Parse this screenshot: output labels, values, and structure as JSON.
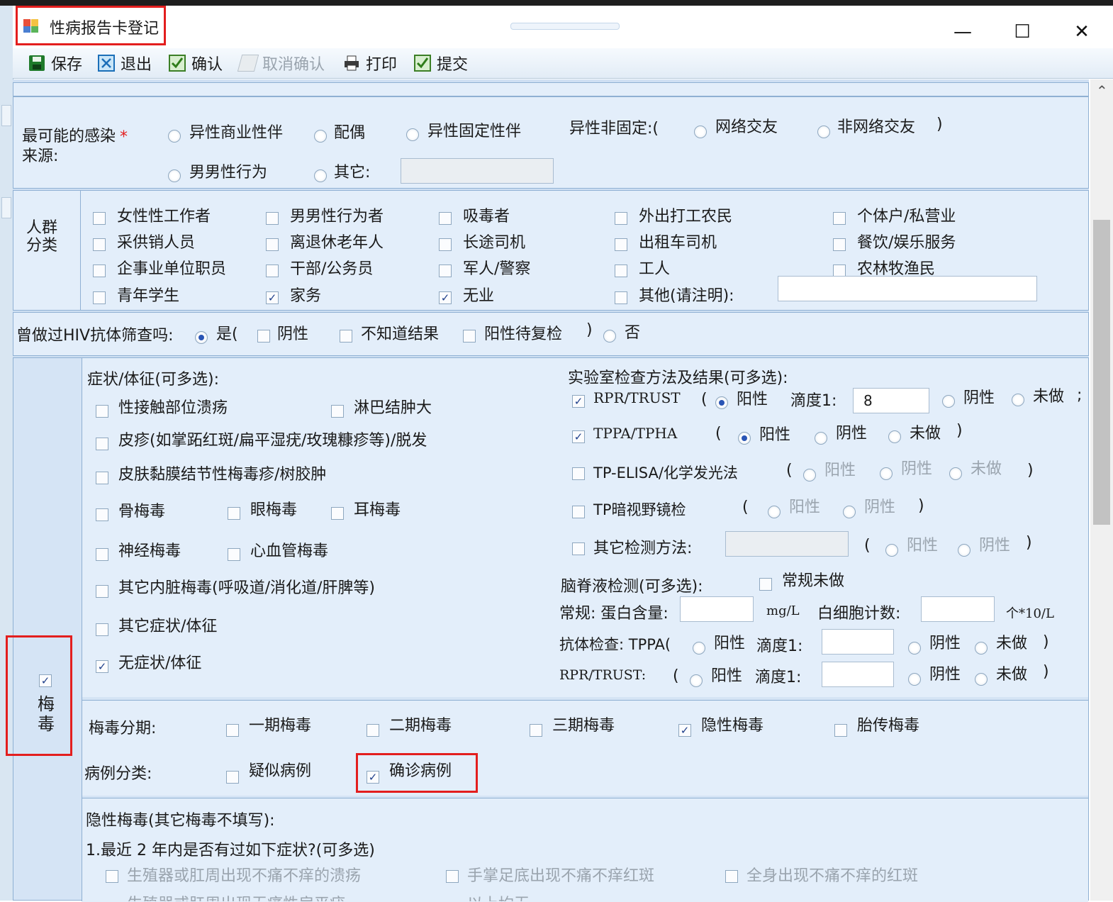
{
  "window": {
    "title": "性病报告卡登记",
    "minimize_glyph": "—",
    "maximize_glyph": "☐",
    "close_glyph": "✕"
  },
  "toolbar": {
    "save": "保存",
    "exit": "退出",
    "confirm": "确认",
    "cancel_confirm": "取消确认",
    "print": "打印",
    "submit": "提交"
  },
  "infection_source": {
    "label": "最可能的感染来源:",
    "options": [
      "异性商业性伴",
      "配偶",
      "异性固定性伴"
    ],
    "nonfixed_label": "异性非固定:(",
    "nonfixed_options": [
      "网络交友",
      "非网络交友"
    ],
    "close_paren": ")",
    "msm": "男男性行为",
    "other": "其它:"
  },
  "population": {
    "label": "人群分类",
    "items": [
      {
        "label": "女性性工作者",
        "checked": false
      },
      {
        "label": "男男性行为者",
        "checked": false
      },
      {
        "label": "吸毒者",
        "checked": false
      },
      {
        "label": "外出打工农民",
        "checked": false
      },
      {
        "label": "个体户/私营业",
        "checked": false
      },
      {
        "label": "采供销人员",
        "checked": false
      },
      {
        "label": "离退休老年人",
        "checked": false
      },
      {
        "label": "长途司机",
        "checked": false
      },
      {
        "label": "出租车司机",
        "checked": false
      },
      {
        "label": "餐饮/娱乐服务",
        "checked": false
      },
      {
        "label": "企事业单位职员",
        "checked": false
      },
      {
        "label": "干部/公务员",
        "checked": false
      },
      {
        "label": "军人/警察",
        "checked": false
      },
      {
        "label": "工人",
        "checked": false
      },
      {
        "label": "农林牧渔民",
        "checked": false
      },
      {
        "label": "青年学生",
        "checked": false
      },
      {
        "label": "家务",
        "checked": true
      },
      {
        "label": "无业",
        "checked": true
      },
      {
        "label": "其他(请注明):",
        "checked": false
      }
    ]
  },
  "hiv": {
    "question": "曾做过HIV抗体筛查吗:",
    "yes": "是(",
    "negative": "阴性",
    "unknown": "不知道结果",
    "pending": "阳性待复检",
    "close": ")",
    "no": "否"
  },
  "syphilis": {
    "side_label": "梅毒",
    "checked": true,
    "symptoms_title": "症状/体征(可多选):",
    "symptoms": [
      {
        "label": "性接触部位溃疡",
        "checked": false
      },
      {
        "label": "淋巴结肿大",
        "checked": false
      },
      {
        "label": "皮疹(如掌跖红斑/扁平湿疣/玫瑰糠疹等)/脱发",
        "checked": false
      },
      {
        "label": "皮肤黏膜结节性梅毒疹/树胶肿",
        "checked": false
      },
      {
        "label": "骨梅毒",
        "checked": false
      },
      {
        "label": "眼梅毒",
        "checked": false
      },
      {
        "label": "耳梅毒",
        "checked": false
      },
      {
        "label": "神经梅毒",
        "checked": false
      },
      {
        "label": "心血管梅毒",
        "checked": false
      },
      {
        "label": "其它内脏梅毒(呼吸道/消化道/肝脾等)",
        "checked": false
      },
      {
        "label": "其它症状/体征",
        "checked": false
      },
      {
        "label": "无症状/体征",
        "checked": true
      }
    ],
    "lab_title": "实验室检查方法及结果(可多选):",
    "lab": {
      "rpr": "RPR/TRUST",
      "tppa": "TPPA/TPHA",
      "elisa": "TP-ELISA/化学发光法",
      "darkfield": "TP暗视野镜检",
      "other": "其它检测方法:",
      "positive": "阳性",
      "negative": "阴性",
      "not_done": "未做",
      "titer": "滴度1:",
      "titer_value": "8",
      "open": "(",
      "close": ")",
      "close_semi": ";"
    },
    "csf": {
      "title": "脑脊液检测(可多选):",
      "routine_not_done": "常规未做",
      "routine": "常规: 蛋白含量:",
      "unit_mg": "mg/L",
      "wbc": "白细胞计数:",
      "unit_wbc": "个*10/L",
      "antibody": "抗体检查: TPPA(",
      "rpr": "RPR/TRUST:",
      "paren": "("
    },
    "staging_label": "梅毒分期:",
    "stages": [
      {
        "label": "一期梅毒",
        "checked": false
      },
      {
        "label": "二期梅毒",
        "checked": false
      },
      {
        "label": "三期梅毒",
        "checked": false
      },
      {
        "label": "隐性梅毒",
        "checked": true
      },
      {
        "label": "胎传梅毒",
        "checked": false
      }
    ],
    "case_label": "病例分类:",
    "cases": [
      {
        "label": "疑似病例",
        "checked": false
      },
      {
        "label": "确诊病例",
        "checked": true
      }
    ]
  },
  "latent": {
    "title": "隐性梅毒(其它梅毒不填写):",
    "q1": "1.最近 2 年内是否有过如下症状?(可多选)",
    "items": [
      "生殖器或肛周出现不痛不痒的溃疡",
      "手掌足底出现不痛不痒红斑",
      "全身出现不痛不痒的红斑",
      "生殖器或肛周出现无痛性扁平疣",
      "以上均无"
    ]
  },
  "check_glyph": "✓",
  "required_mark": "*",
  "scroll_up": "⌃",
  "colors": {
    "highlight": "#e31e1e",
    "panel": "#e3eefa",
    "border": "#8fb0d3",
    "radio_dot": "#2a55b5"
  }
}
